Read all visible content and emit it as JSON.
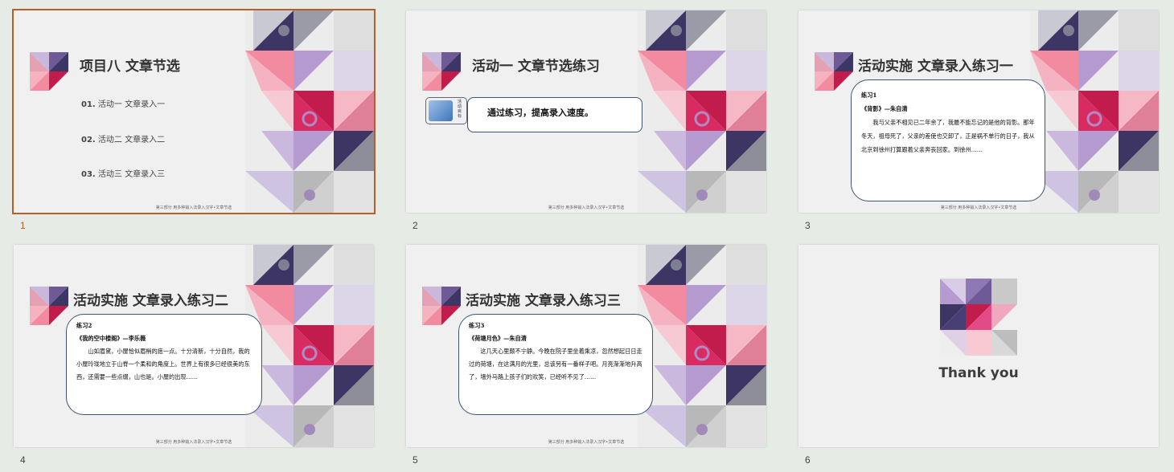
{
  "footer": "第三部分 用多种输入法录入汉字•文章节选",
  "slides": [
    {
      "number": "1",
      "title": "项目八   文章节选",
      "agenda": [
        {
          "num": "01.",
          "label": "活动一  文章录入一"
        },
        {
          "num": "02.",
          "label": "活动二  文章录入二"
        },
        {
          "num": "03.",
          "label": "活动三  文章录入三"
        }
      ]
    },
    {
      "number": "2",
      "title": "活动一   文章节选练习",
      "badge_label": "活动目标",
      "goal": "通过练习，提高录入速度。"
    },
    {
      "number": "3",
      "title": "活动实施   文章录入练习一",
      "exercise": {
        "heading": "练习1",
        "source": "《背影》—朱自清",
        "body": "我与父亲不相见已二年余了，我最不能忘记的是他的背影。那年冬天，祖母死了，父亲的差使也交卸了，正是祸不单行的日子，我从北京到徐州打算跟着父亲奔丧回家。到徐州……"
      }
    },
    {
      "number": "4",
      "title": "活动实施   文章录入练习二",
      "exercise": {
        "heading": "练习2",
        "source": "《我的空中楼阁》—李乐薇",
        "body": "山如眉黛，小屋恰似眉梢的痣一点。十分清新，十分自然，我的小屋玲珑地立于山脊一个柔和的角度上。世界上有很多已经很美的东西，还需要一些点缀，山也是。小屋的出现……"
      }
    },
    {
      "number": "5",
      "title": "活动实施   文章录入练习三",
      "exercise": {
        "heading": "练习3",
        "source": "《荷塘月色》—朱自清",
        "body": "这几天心里颇不宁静。今晚在院子里坐着乘凉，忽然想起日日走过的荷塘，在这满月的光里，总该另有一番样子吧。月亮渐渐地升高了，墙外马路上孩子们的欢笑，已经听不见了……"
      }
    },
    {
      "number": "6",
      "thanks": "Thank you"
    }
  ]
}
